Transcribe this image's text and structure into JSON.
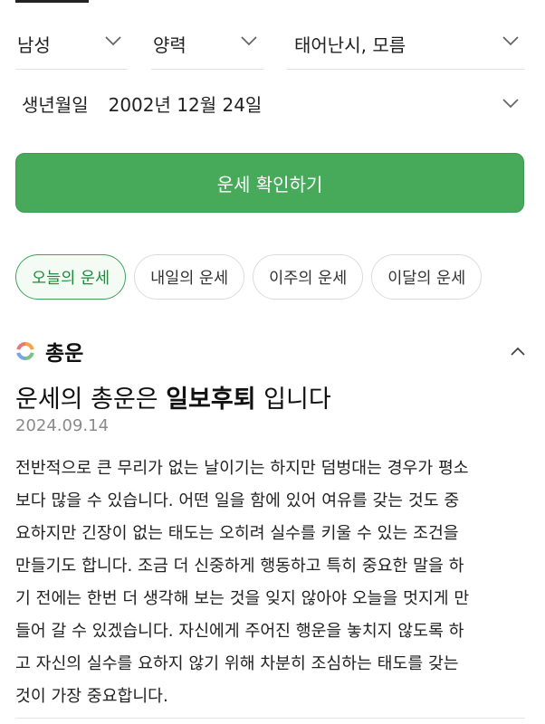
{
  "filters": {
    "gender": "남성",
    "calendar": "양력",
    "birth_time": "태어난시, 모름"
  },
  "birthdate": {
    "label": "생년월일",
    "value": "2002년 12월 24일"
  },
  "cta_label": "운세 확인하기",
  "period_tabs": [
    {
      "label": "오늘의 운세",
      "active": true
    },
    {
      "label": "내일의 운세",
      "active": false
    },
    {
      "label": "이주의 운세",
      "active": false
    },
    {
      "label": "이달의 운세",
      "active": false
    }
  ],
  "section": {
    "title": "총운",
    "headline_prefix": "운세의 총운은 ",
    "headline_emphasis": "일보후퇴",
    "headline_suffix": " 입니다",
    "date": "2024.09.14",
    "body_lines": [
      "전반적으로 큰 무리가 없는 날이기는 하지만 덤벙대는 경우가 평소",
      "보다 많을 수 있습니다. 어떤 일을 함에 있어 여유를 갖는 것도 중",
      "요하지만 긴장이 없는 태도는 오히려 실수를 키울 수 있는 조건을",
      "만들기도 합니다. 조금 더 신중하게 행동하고 특히 중요한 말을 하",
      "기 전에는 한번 더 생각해 보는 것을 잊지 않아야 오늘을 멋지게 만",
      "들어 갈 수 있겠습니다. 자신에게 주어진 행운을 놓치지 않도록 하",
      "고 자신의 실수를 요하지 않기 위해 차분히 조심하는 태도를 갖는",
      "것이 가장 중요합니다."
    ]
  },
  "colors": {
    "accent_green": "#47a95a",
    "active_tab_text": "#1f8a3c",
    "date_gray": "#8a8a8a"
  },
  "icons": {
    "dropdown": "chevron-down-icon",
    "collapse": "chevron-up-icon",
    "section": "fortune-ring-icon"
  }
}
